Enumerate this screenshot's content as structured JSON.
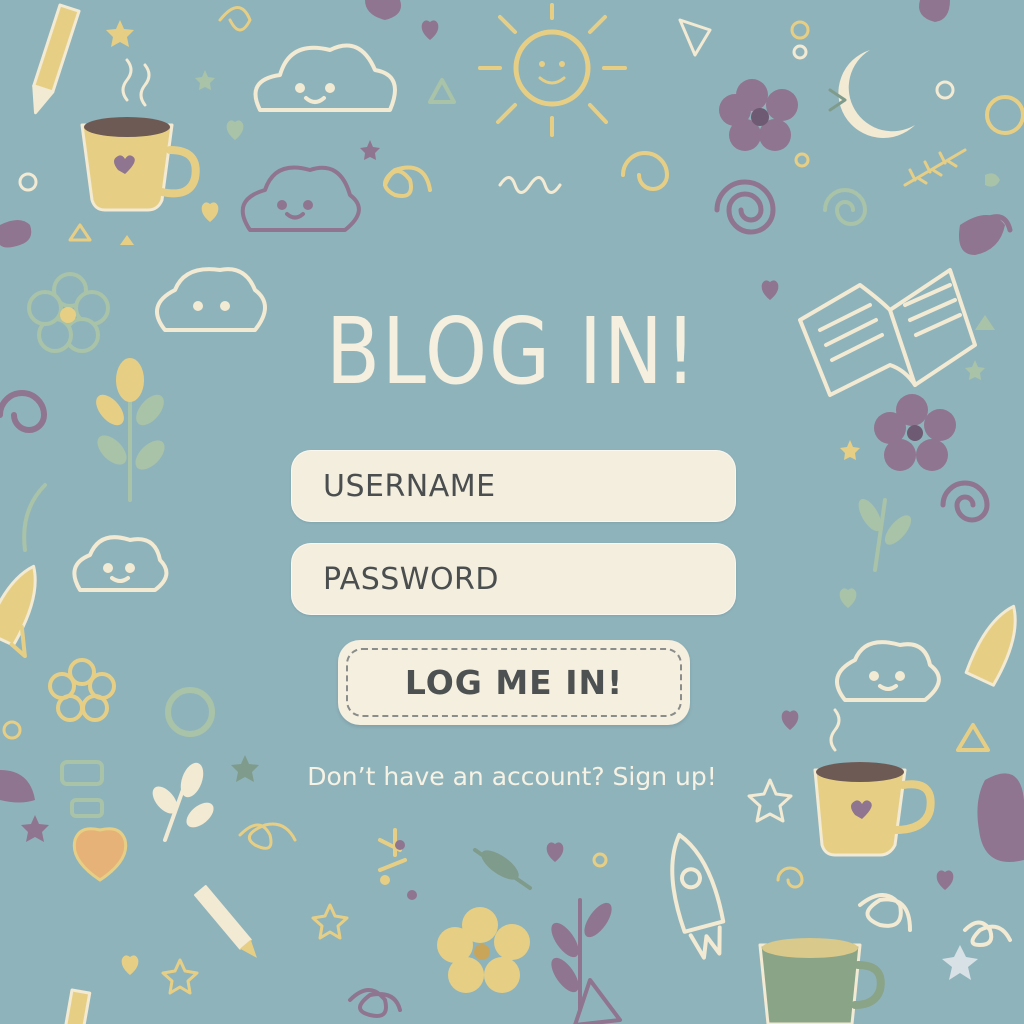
{
  "login": {
    "title": "BLOG IN!",
    "username_placeholder": "USERNAME",
    "password_placeholder": "PASSWORD",
    "submit_label": "LOG ME IN!",
    "signup_text": "Don’t have an account? Sign up!"
  },
  "theme": {
    "background": "#8fb3bb",
    "card_cream": "#f3eede",
    "text_dark": "#4a4e4f",
    "doodle_yellow": "#e6cf85",
    "doodle_purple": "#8f7590",
    "doodle_cream": "#f2ead3",
    "doodle_green": "#a9c3a8",
    "doodle_pink": "#c99aa5"
  },
  "decorations": [
    "pencil-icon",
    "coffee-cup-icon",
    "sun-icon",
    "cloud-icon",
    "moon-icon",
    "flower-icon",
    "open-book-icon",
    "rocket-icon",
    "star-icon",
    "heart-icon",
    "leaf-icon",
    "spiral-icon"
  ]
}
